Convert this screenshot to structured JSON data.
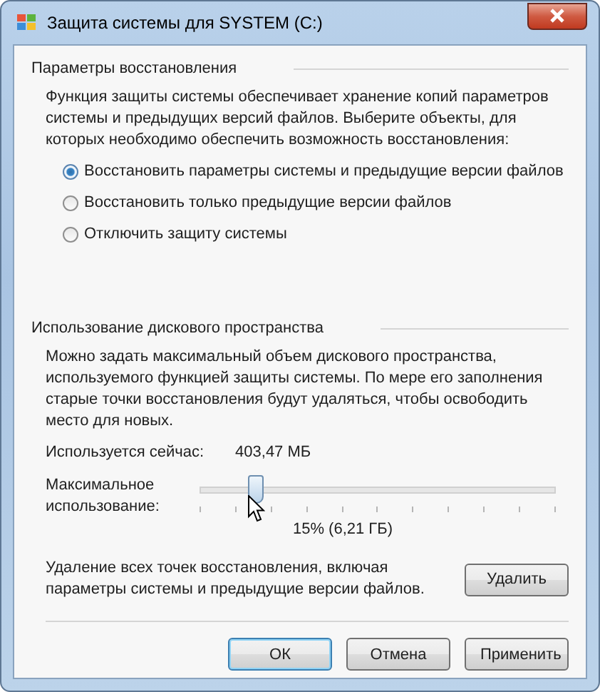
{
  "window": {
    "title": "Защита системы для SYSTEM (C:)"
  },
  "restore_settings": {
    "heading": "Параметры восстановления",
    "description": "Функция защиты системы обеспечивает хранение копий параметров системы и предыдущих версий файлов. Выберите объекты, для которых необходимо обеспечить возможность восстановления:",
    "options": [
      {
        "label": "Восстановить параметры системы и предыдущие версии файлов",
        "selected": true
      },
      {
        "label": "Восстановить только предыдущие версии файлов",
        "selected": false
      },
      {
        "label": "Отключить защиту системы",
        "selected": false
      }
    ]
  },
  "disk_usage": {
    "heading": "Использование дискового пространства",
    "description": "Можно задать максимальный объем дискового пространства, используемого функцией защиты системы. По мере его заполнения старые точки восстановления будут удаляться, чтобы освободить место для новых.",
    "current_usage_label": "Используется сейчас:",
    "current_usage_value": "403,47 МБ",
    "max_usage_label": "Максимальное использование:",
    "max_usage_slider": {
      "level": 0.15
    },
    "max_usage_reading": "15% (6,21 ГБ)",
    "delete_description": "Удаление всех точек восстановления, включая параметры системы и предыдущие версии файлов.",
    "delete_button": "Удалить"
  },
  "buttons": [
    {
      "label": "ОК",
      "default": true
    },
    {
      "label": "Отмена",
      "default": false
    },
    {
      "label": "Применить",
      "default": false
    }
  ]
}
